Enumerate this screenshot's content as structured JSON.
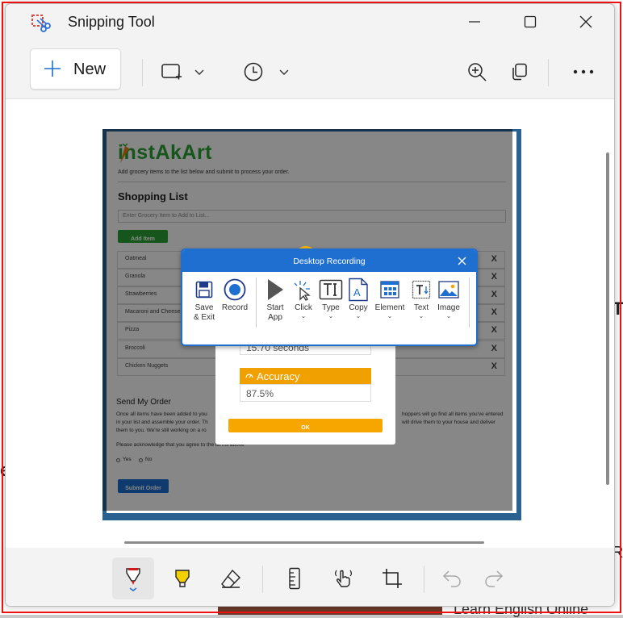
{
  "window": {
    "title": "Snipping Tool"
  },
  "toolbar": {
    "new_label": "New"
  },
  "site": {
    "brand": "instAkArt",
    "intro": "Add grocery items to the list below and submit to process your order.",
    "heading": "Shopping List",
    "input_placeholder": "Enter Grocery Item to Add to List...",
    "add_button": "Add Item",
    "items": [
      "Oatmeal",
      "Granola",
      "Strawberries",
      "Macaroni and Cheese",
      "Pizza",
      "Broccoli",
      "Chicken Nuggets"
    ],
    "remove_glyph": "X",
    "order_heading": "Send My Order",
    "order_text_1": "Once all items have been added to you",
    "order_text_1b": "hoppers will go find all items you've entered",
    "order_text_2": "in your list and assemble your order. Th",
    "order_text_2b": "will drive them to your house and deliver",
    "order_text_3": "them to you. We're still working on a ro",
    "acknowledge": "Please acknowledge that you agree to the terms above",
    "yes": "Yes",
    "no": "No",
    "submit_button": "Submit Order"
  },
  "result_popup": {
    "time_value": "15.70 seconds",
    "accuracy_label": "Accuracy",
    "accuracy_value": "87.5%",
    "ok_button": "OK"
  },
  "desktop_recording": {
    "title": "Desktop Recording",
    "tools": [
      {
        "label": "Save",
        "label2": "& Exit",
        "icon": "floppy-disk-icon"
      },
      {
        "label": "Record",
        "label2": "",
        "icon": "record-icon"
      },
      {
        "label": "Start",
        "label2": "App",
        "icon": "play-icon"
      },
      {
        "label": "Click",
        "label2": "",
        "icon": "cursor-click-icon"
      },
      {
        "label": "Type",
        "label2": "",
        "icon": "text-input-icon"
      },
      {
        "label": "Copy",
        "label2": "",
        "icon": "document-copy-icon"
      },
      {
        "label": "Element",
        "label2": "",
        "icon": "grid-element-icon"
      },
      {
        "label": "Text",
        "label2": "",
        "icon": "text-extract-icon"
      },
      {
        "label": "Image",
        "label2": "",
        "icon": "image-icon"
      }
    ]
  },
  "background": {
    "fragment_1": "Learn English Online",
    "fragment_2": "e",
    "fragment_3": "Ri",
    "fragment_4": "T"
  },
  "colors": {
    "accent": "#1e6fcf",
    "brand_orange": "#f7a600",
    "brand_green": "#2aa135",
    "frame_red": "#e11111"
  }
}
